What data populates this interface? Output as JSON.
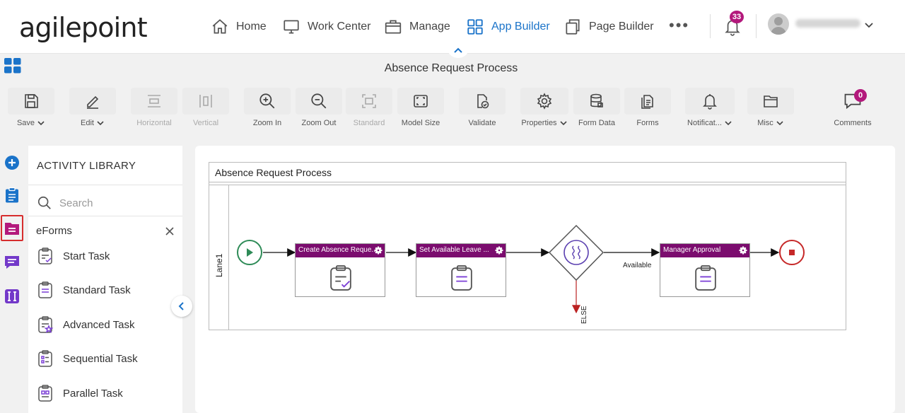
{
  "header": {
    "logo": "agilepoint",
    "nav": [
      {
        "label": "Home",
        "icon": "home-icon"
      },
      {
        "label": "Work Center",
        "icon": "monitor-icon"
      },
      {
        "label": "Manage",
        "icon": "briefcase-icon"
      },
      {
        "label": "App Builder",
        "icon": "apps-grid-icon"
      },
      {
        "label": "Page Builder",
        "icon": "copy-pages-icon"
      }
    ],
    "notifications_count": "33",
    "accent_color": "#1a73c9",
    "badge_color": "#b3197c"
  },
  "page_title": "Absence Request Process",
  "toolbar": [
    {
      "label": "Save",
      "icon": "save-icon",
      "dropdown": true
    },
    {
      "label": "Edit",
      "icon": "pencil-icon",
      "dropdown": true
    },
    {
      "label": "Horizontal",
      "icon": "horizontal-align-icon",
      "disabled": true
    },
    {
      "label": "Vertical",
      "icon": "vertical-align-icon",
      "disabled": true
    },
    {
      "label": "Zoom In",
      "icon": "zoom-in-icon"
    },
    {
      "label": "Zoom Out",
      "icon": "zoom-out-icon"
    },
    {
      "label": "Standard",
      "icon": "standard-size-icon",
      "disabled": true
    },
    {
      "label": "Model Size",
      "icon": "model-size-icon"
    },
    {
      "label": "Validate",
      "icon": "validate-icon"
    },
    {
      "label": "Properties",
      "icon": "gear-icon",
      "dropdown": true
    },
    {
      "label": "Form Data",
      "icon": "database-icon"
    },
    {
      "label": "Forms",
      "icon": "forms-icon"
    },
    {
      "label": "Notificat...",
      "icon": "bell-icon",
      "dropdown": true
    },
    {
      "label": "Misc",
      "icon": "folder-icon",
      "dropdown": true
    },
    {
      "label": "Comments",
      "icon": "comment-icon",
      "count": "0"
    }
  ],
  "library": {
    "title": "ACTIVITY LIBRARY",
    "search_placeholder": "Search",
    "category": "eForms",
    "items": [
      "Start Task",
      "Standard Task",
      "Advanced Task",
      "Sequential Task",
      "Parallel Task"
    ]
  },
  "diagram": {
    "pool_title": "Absence Request Process",
    "lane": "Lane1",
    "tasks": [
      "Create Absence Reque...",
      "Set Available Leave ...",
      "Manager Approval"
    ],
    "available_label": "Available",
    "else_label": "ELSE",
    "task_header_color": "#7b0c6e"
  }
}
